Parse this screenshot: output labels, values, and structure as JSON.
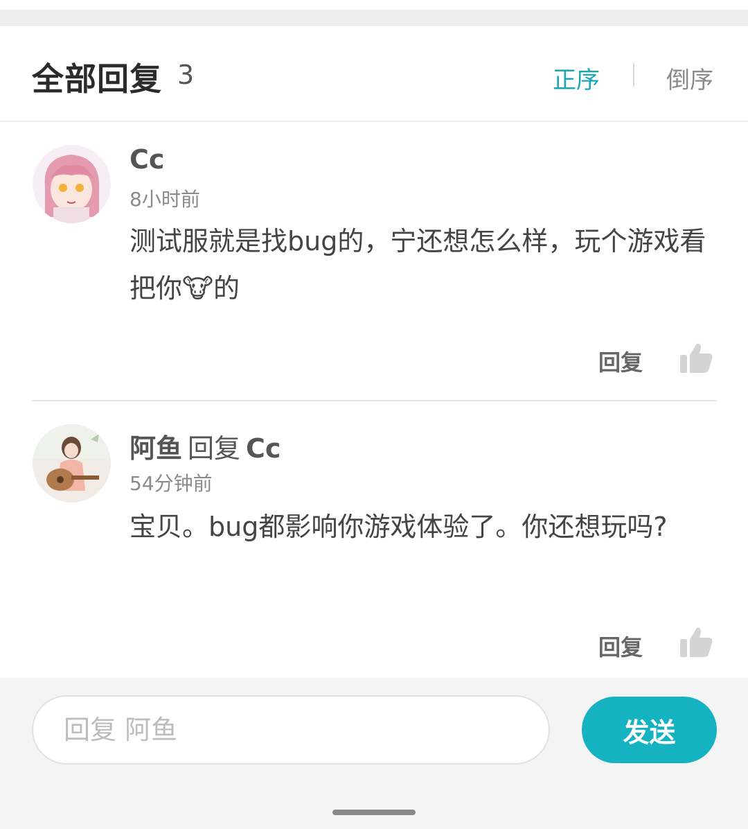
{
  "header": {
    "title": "全部回复",
    "count": "3",
    "sort_asc": "正序",
    "sort_desc": "倒序"
  },
  "comments": [
    {
      "author": "Cc",
      "reply_word": "",
      "reply_to": "",
      "time": "8小时前",
      "content": "测试服就是找bug的，宁还想怎么样，玩个游戏看把你🐮的",
      "reply_label": "回复"
    },
    {
      "author": "阿鱼",
      "reply_word": "回复",
      "reply_to": "Cc",
      "time": "54分钟前",
      "content": "宝贝。bug都影响你游戏体验了。你还想玩吗?",
      "reply_label": "回复"
    }
  ],
  "footer": {
    "input_placeholder": "回复 阿鱼",
    "send_label": "发送"
  },
  "colors": {
    "accent": "#15b2c2",
    "sort_active": "#1aa7b4"
  }
}
